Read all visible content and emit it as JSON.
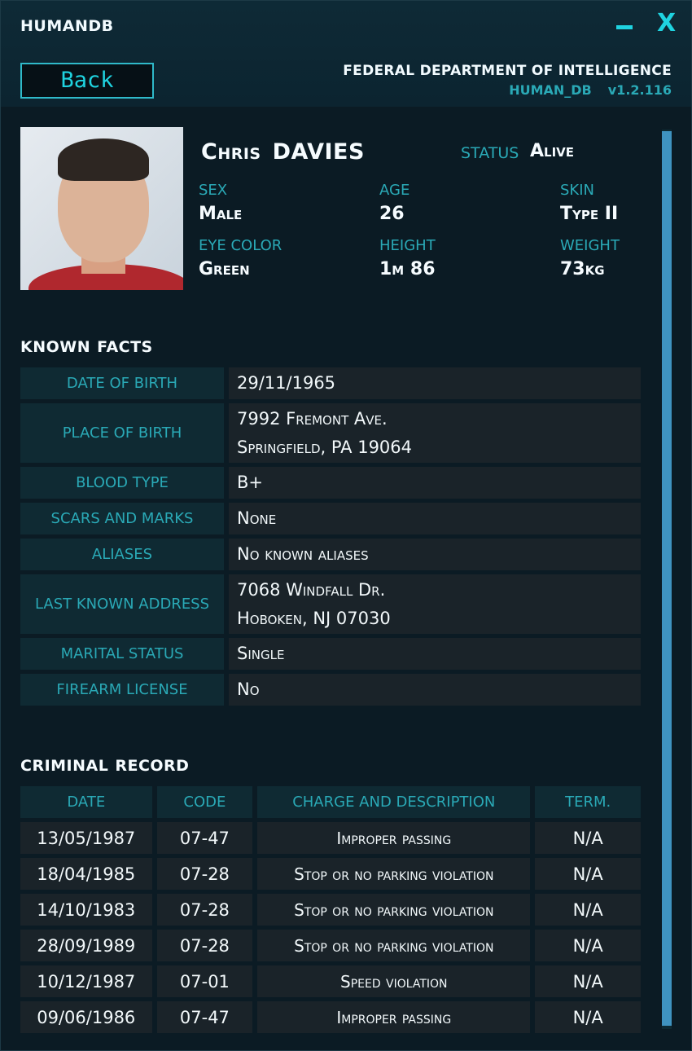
{
  "window": {
    "title": "HUMANDB",
    "minimize_label": "",
    "close_label": "X"
  },
  "header": {
    "back_label": "Back",
    "agency": "FEDERAL DEPARTMENT OF INTELLIGENCE",
    "db_name": "HUMAN_DB",
    "version": "v1.2.116"
  },
  "profile": {
    "first_name": "Chris",
    "last_name": "DAVIES",
    "status_label": "STATUS",
    "status_value": "Alive",
    "attributes": [
      {
        "label": "SEX",
        "value": "Male"
      },
      {
        "label": "AGE",
        "value": "26"
      },
      {
        "label": "SKIN",
        "value": "Type II"
      },
      {
        "label": "EYE COLOR",
        "value": "Green"
      },
      {
        "label": "HEIGHT",
        "value": "1m 86"
      },
      {
        "label": "WEIGHT",
        "value": "73kg"
      }
    ]
  },
  "known_facts": {
    "title_a": "KNOWN",
    "title_b": "FACTS",
    "rows": [
      {
        "key": "DATE OF BIRTH",
        "lines": [
          "29/11/1965"
        ]
      },
      {
        "key": "PLACE OF BIRTH",
        "lines": [
          "7992 Fremont Ave.",
          "Springfield, PA 19064"
        ]
      },
      {
        "key": "BLOOD TYPE",
        "lines": [
          "B+"
        ]
      },
      {
        "key": "SCARS AND MARKS",
        "lines": [
          "None"
        ]
      },
      {
        "key": "ALIASES",
        "lines": [
          "No known aliases"
        ]
      },
      {
        "key": "LAST KNOWN ADDRESS",
        "lines": [
          "7068 Windfall Dr.",
          "Hoboken, NJ 07030"
        ]
      },
      {
        "key": "MARITAL STATUS",
        "lines": [
          "Single"
        ]
      },
      {
        "key": "FIREARM LICENSE",
        "lines": [
          "No"
        ]
      }
    ]
  },
  "criminal_record": {
    "title_a": "CRIMINAL",
    "title_b": "RECORD",
    "headers": {
      "date": "DATE",
      "code": "CODE",
      "desc": "CHARGE AND DESCRIPTION",
      "term": "TERM."
    },
    "rows": [
      {
        "date": "13/05/1987",
        "code": "07-47",
        "desc": "Improper passing",
        "term": "N/A"
      },
      {
        "date": "18/04/1985",
        "code": "07-28",
        "desc": "Stop or no parking violation",
        "term": "N/A"
      },
      {
        "date": "14/10/1983",
        "code": "07-28",
        "desc": "Stop or no parking violation",
        "term": "N/A"
      },
      {
        "date": "28/09/1989",
        "code": "07-28",
        "desc": "Stop or no parking violation",
        "term": "N/A"
      },
      {
        "date": "10/12/1987",
        "code": "07-01",
        "desc": "Speed violation",
        "term": "N/A"
      },
      {
        "date": "09/06/1986",
        "code": "07-47",
        "desc": "Improper passing",
        "term": "N/A"
      }
    ]
  },
  "colors": {
    "accent": "#1fd3e0",
    "label": "#2aa9b6",
    "scrollbar": "#3f93c0"
  }
}
